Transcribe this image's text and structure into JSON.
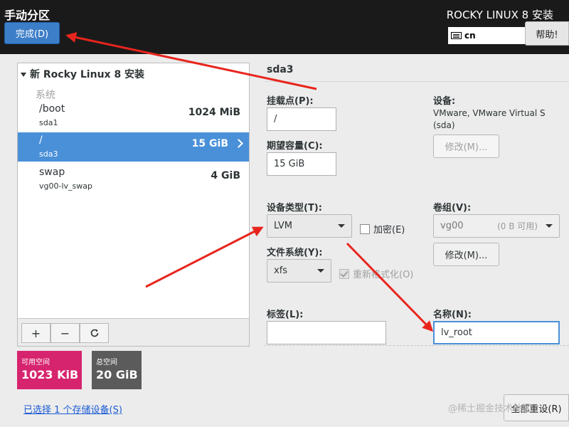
{
  "header": {
    "page_title": "手动分区",
    "done_button": "完成(D)",
    "product_title": "ROCKY LINUX 8 安装",
    "keyboard_layout": "cn",
    "help_button": "帮助!"
  },
  "left_panel": {
    "install_heading": "新 Rocky Linux 8 安装",
    "group_label": "系统",
    "mounts": [
      {
        "mount_point": "/boot",
        "device": "sda1",
        "size": "1024 MiB",
        "selected": false
      },
      {
        "mount_point": "/",
        "device": "sda3",
        "size": "15 GiB",
        "selected": true
      },
      {
        "mount_point": "swap",
        "device": "vg00-lv_swap",
        "size": "4 GiB",
        "selected": false
      }
    ],
    "toolbar": {
      "add": "+",
      "remove": "−",
      "refresh": "↻"
    }
  },
  "space": {
    "available_label": "可用空间",
    "available_value": "1023 KiB",
    "available_color": "#d6246e",
    "total_label": "总空间",
    "total_value": "20 GiB",
    "total_color": "#5b5b5b"
  },
  "storage_link": "已选择 1 个存储设备(S)",
  "detail": {
    "title": "sda3",
    "mount_point_label": "挂载点(P):",
    "mount_point_value": "/",
    "capacity_label": "期望容量(C):",
    "capacity_value": "15 GiB",
    "device_label": "设备:",
    "device_name": "VMware, VMware Virtual S",
    "device_id": "(sda)",
    "device_modify_button": "修改(M)...",
    "device_type_label": "设备类型(T):",
    "device_type_value": "LVM",
    "encrypt_label": "加密(E)",
    "volume_group_label": "卷组(V):",
    "volume_group_value": "vg00",
    "volume_group_free": "(0 B 可用)",
    "volume_group_modify_button": "修改(M)...",
    "filesystem_label": "文件系统(Y):",
    "filesystem_value": "xfs",
    "reformat_label": "重新格式化(O)",
    "label_label": "标签(L):",
    "label_value": "",
    "name_label": "名称(N):",
    "name_value": "lv_root"
  },
  "watermark": "@稀土掘金技术社区",
  "reset_button": "全部重设(R)",
  "annotation_color": "#e8251d"
}
